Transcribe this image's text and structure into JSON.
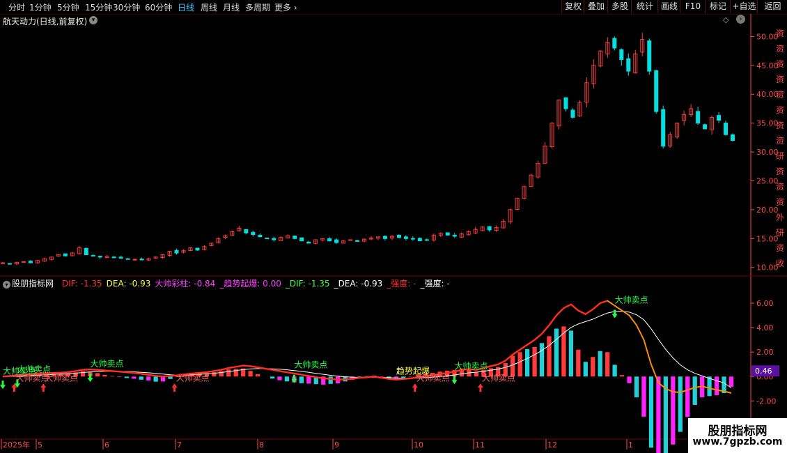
{
  "toolbar": {
    "timeframes": [
      "分时",
      "1分钟",
      "5分钟",
      "15分钟",
      "30分钟",
      "60分钟",
      "日线",
      "周线",
      "月线",
      "多周期",
      "更多"
    ],
    "active": "日线",
    "right_buttons": [
      "复权",
      "叠加",
      "多股",
      "统计",
      "画线",
      "F10",
      "标记",
      "+自选",
      "返回"
    ]
  },
  "stock": {
    "title": "航天动力(日线,前复权)"
  },
  "colors": {
    "up": "#ff3b3b",
    "down": "#00e0e0",
    "bg": "#000000",
    "grid": "#5a0000",
    "axis": "#ff4a4a",
    "dif": "#ff2020",
    "dea": "#ffffff",
    "orange": "#ff8c00",
    "magenta": "#ff22ff",
    "cyan": "#22d0d8",
    "green": "#22ff44"
  },
  "price_axis": {
    "ticks": [
      "50.00",
      "45.00",
      "40.00",
      "35.00",
      "30.00",
      "25.00",
      "20.00",
      "15.00",
      "10.00"
    ]
  },
  "indicator_axis": {
    "ticks": [
      "6.00",
      "4.00",
      "2.00",
      "0.00",
      "-2.00"
    ],
    "current": "0.46"
  },
  "indicator_header": {
    "name": "股朋指标网",
    "items": [
      {
        "text": "DIF: -1.35",
        "color": "#ff3030"
      },
      {
        "text": "DEA: -0.93",
        "color": "#ffff40"
      },
      {
        "text": "大帅彩柱: -0.84",
        "color": "#ff40ff"
      },
      {
        "text": "_趋势起爆: 0.00",
        "color": "#ff40ff"
      },
      {
        "text": "_DIF: -1.35",
        "color": "#40ff40"
      },
      {
        "text": "_DEA: -0.93",
        "color": "#ffffff"
      },
      {
        "text": "_强度: -",
        "color": "#ff3030"
      },
      {
        "text": "_强度: -",
        "color": "#ffffff"
      }
    ]
  },
  "time_axis": {
    "labels": [
      "2025年",
      "5",
      "6",
      "7",
      "8",
      "9",
      "10",
      "11",
      "12",
      "1"
    ]
  },
  "signals": {
    "sell_label": "大帅卖点",
    "burst_label": "趋势起爆"
  },
  "side_text": "资 | 资 | 资 | 资 | 资 | 资 | 资 | 资 | 研 | 资 | 资 | 资 | 外 | 研 | 资 | 收",
  "watermark": {
    "line1": "股朋指标网",
    "line2": "www.7gpzb.com"
  },
  "chart_data": {
    "type": "candlestick",
    "ylim": [
      9,
      51.5
    ],
    "close_series": [
      10.8,
      10.6,
      10.9,
      11.0,
      10.8,
      11.2,
      11.5,
      11.8,
      12.2,
      12.0,
      12.5,
      13.4,
      12.2,
      12.0,
      11.8,
      11.9,
      11.7,
      11.6,
      11.5,
      11.4,
      11.3,
      11.5,
      11.8,
      12.2,
      12.8,
      12.5,
      12.9,
      13.4,
      13.0,
      13.6,
      14.2,
      15.0,
      15.5,
      16.2,
      16.8,
      16.0,
      15.7,
      15.3,
      15.0,
      14.8,
      15.2,
      15.5,
      15.0,
      14.6,
      14.2,
      14.8,
      15.0,
      14.6,
      14.3,
      14.6,
      14.8,
      14.5,
      14.9,
      15.1,
      15.3,
      15.0,
      15.4,
      15.2,
      15.0,
      14.9,
      14.6,
      14.8,
      15.6,
      15.9,
      15.6,
      15.4,
      15.8,
      16.2,
      16.6,
      17.0,
      16.5,
      16.9,
      18.0,
      20.0,
      22.0,
      24.0,
      26.0,
      28.0,
      31.0,
      35.0,
      39.0,
      37.5,
      36.0,
      38.5,
      42.0,
      45.0,
      47.5,
      49.0,
      48.0,
      46.0,
      44.0,
      47.0,
      49.5,
      44.0,
      37.0,
      31.0,
      33.0,
      35.0,
      36.5,
      37.5,
      35.0,
      34.0,
      36.0,
      35.5,
      33.0,
      32.0
    ],
    "dif": [
      0.0,
      0.05,
      0.12,
      0.18,
      0.2,
      0.25,
      0.28,
      0.3,
      0.32,
      0.36,
      0.45,
      0.55,
      0.58,
      0.55,
      0.5,
      0.45,
      0.4,
      0.35,
      0.3,
      0.22,
      0.15,
      0.05,
      0.0,
      0.05,
      0.1,
      0.18,
      0.25,
      0.3,
      0.36,
      0.45,
      0.55,
      0.7,
      0.8,
      0.9,
      0.85,
      0.75,
      0.65,
      0.55,
      0.45,
      0.35,
      0.25,
      0.15,
      0.05,
      -0.05,
      -0.15,
      -0.2,
      -0.25,
      -0.22,
      -0.18,
      -0.1,
      -0.05,
      -0.02,
      -0.1,
      -0.2,
      -0.25,
      -0.2,
      -0.15,
      -0.05,
      0.02,
      0.1,
      0.2,
      0.3,
      0.4,
      0.55,
      0.6,
      0.55,
      0.7,
      0.85,
      1.0,
      1.3,
      1.8,
      2.2,
      2.6,
      3.0,
      3.5,
      4.2,
      5.0,
      5.6,
      5.9,
      5.4,
      5.1,
      5.5,
      6.0,
      6.2,
      5.8,
      5.4,
      5.0,
      4.2,
      3.0,
      1.0,
      -0.5,
      -1.0,
      -1.25,
      -1.3,
      -1.1,
      -0.9,
      -0.8,
      -0.95,
      -1.1,
      -1.2,
      -1.35
    ],
    "dea": [
      0.0,
      0.01,
      0.03,
      0.06,
      0.09,
      0.12,
      0.15,
      0.18,
      0.21,
      0.24,
      0.28,
      0.33,
      0.38,
      0.41,
      0.43,
      0.43,
      0.42,
      0.41,
      0.39,
      0.35,
      0.31,
      0.26,
      0.2,
      0.15,
      0.12,
      0.12,
      0.15,
      0.18,
      0.22,
      0.27,
      0.33,
      0.41,
      0.49,
      0.57,
      0.62,
      0.65,
      0.65,
      0.63,
      0.6,
      0.55,
      0.49,
      0.42,
      0.34,
      0.26,
      0.18,
      0.1,
      0.03,
      -0.02,
      -0.05,
      -0.07,
      -0.07,
      -0.06,
      -0.07,
      -0.09,
      -0.12,
      -0.14,
      -0.14,
      -0.12,
      -0.09,
      -0.05,
      0.0,
      0.06,
      0.13,
      0.22,
      0.3,
      0.36,
      0.43,
      0.51,
      0.61,
      0.75,
      0.95,
      1.2,
      1.48,
      1.79,
      2.13,
      2.55,
      3.04,
      3.55,
      4.02,
      4.3,
      4.5,
      4.7,
      4.96,
      5.2,
      5.32,
      5.34,
      5.27,
      5.05,
      4.64,
      3.91,
      3.03,
      2.22,
      1.53,
      0.96,
      0.55,
      0.26,
      0.05,
      -0.15,
      -0.34,
      -0.52,
      -0.93
    ]
  }
}
